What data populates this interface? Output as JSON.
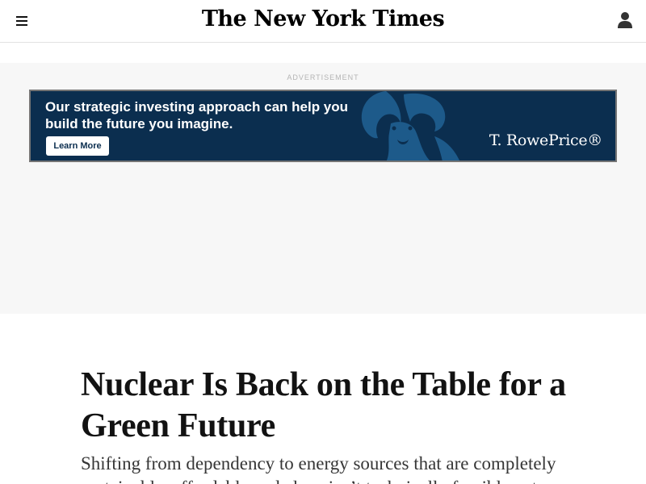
{
  "header": {
    "logo": "The New York Times",
    "menu_icon": "hamburger-menu-icon",
    "account_icon": "user-account-icon"
  },
  "ad": {
    "label": "ADVERTISEMENT",
    "headline": "Our strategic investing approach can help you build the future you imagine.",
    "cta": "Learn More",
    "brand": "T. RowePrice®",
    "art_icon": "bighorn-ram-icon",
    "colors": {
      "banner": "#0b2e4f",
      "art": "#1d5a8a"
    }
  },
  "article": {
    "headline": "Nuclear Is Back on the Table for a Green Future",
    "summary": "Shifting from dependency to energy sources that are completely sustainable, affordable and clean isn’t technically feasible yet."
  }
}
